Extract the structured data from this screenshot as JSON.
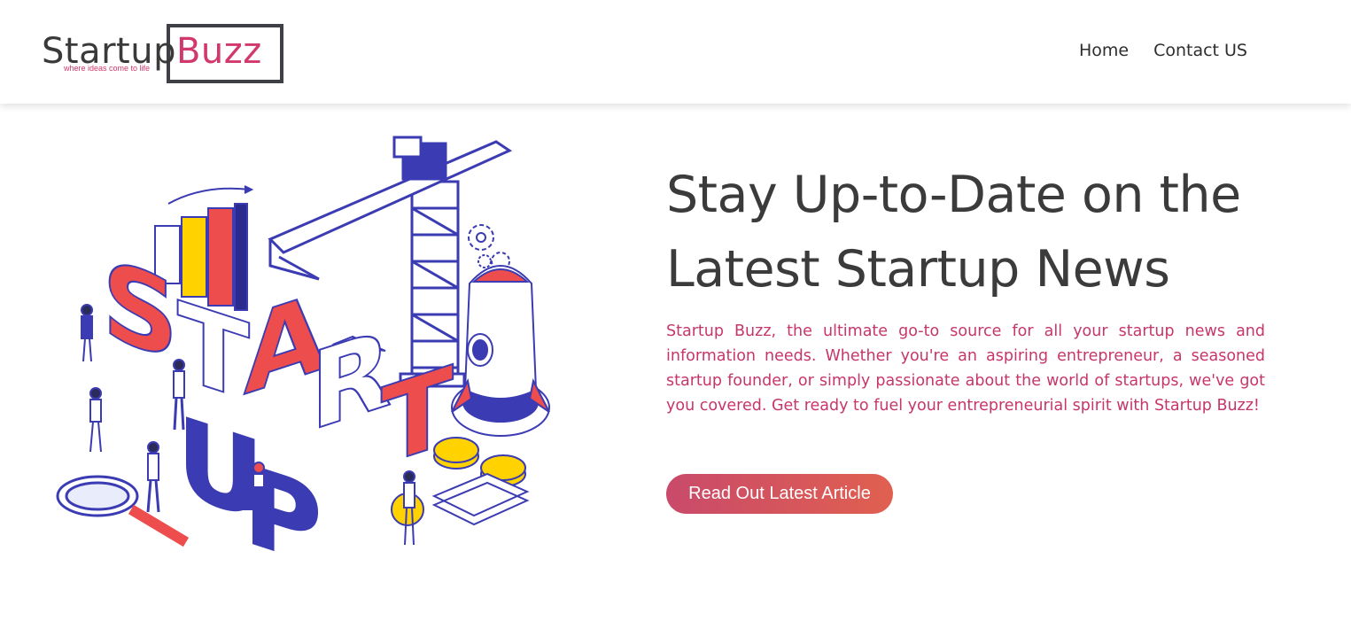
{
  "brand": {
    "name_part1": "Startup",
    "name_part2": "Buzz",
    "tagline": "where ideas come to life"
  },
  "nav": {
    "links": [
      {
        "label": "Home"
      },
      {
        "label": "Contact US"
      }
    ]
  },
  "hero": {
    "title": "Stay Up-to-Date on the Latest Startup News",
    "description": "Startup Buzz, the ultimate go-to source for all your startup news and information needs. Whether you're an aspiring entrepreneur, a seasoned startup founder, or simply passionate about the world of startups, we've got you covered. Get ready to fuel your entrepreneurial spirit with Startup Buzz!",
    "cta_label": "Read Out Latest Article",
    "illustration_letters": [
      "S",
      "T",
      "A",
      "R",
      "T",
      "U",
      "P"
    ]
  },
  "colors": {
    "accent_pink": "#d1386b",
    "accent_red": "#ee4d4d",
    "illustration_blue": "#3b3bb3",
    "illustration_yellow": "#ffd200",
    "text_dark": "#3a3a3a"
  },
  "icons": [
    "rocket-icon",
    "magnifier-icon",
    "gear-icon",
    "coin-icon",
    "paper-plane-icon",
    "crane-icon",
    "bar-chart-icon"
  ]
}
